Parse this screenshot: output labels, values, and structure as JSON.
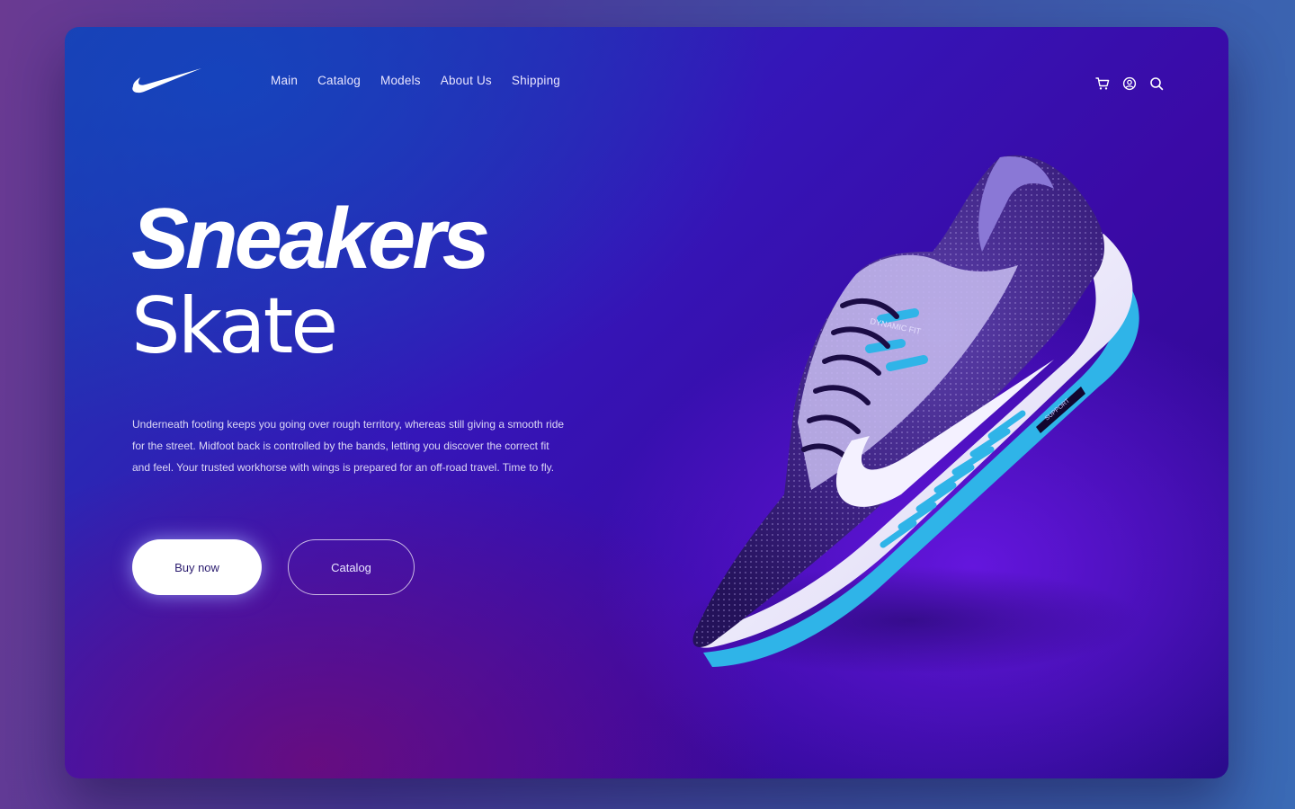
{
  "brand": {
    "logo_icon": "swoosh-logo-icon"
  },
  "nav": {
    "items": [
      {
        "label": "Main"
      },
      {
        "label": "Catalog"
      },
      {
        "label": "Models"
      },
      {
        "label": "About Us"
      },
      {
        "label": "Shipping"
      }
    ]
  },
  "header_icons": [
    "cart-icon",
    "account-icon",
    "search-icon"
  ],
  "hero": {
    "title_line1": "Sneakers",
    "title_line2": "Skate",
    "description": "Underneath footing keeps you going over rough territory, whereas still giving a smooth ride for the street. Midfoot back is controlled by the bands, letting you discover the correct fit and feel. Your trusted workhorse with wings is prepared for an off-road travel. Time to fly."
  },
  "buttons": {
    "buy_now": "Buy now",
    "catalog": "Catalog"
  },
  "product_image": {
    "label_dynamic_fit": "DYNAMIC FIT",
    "label_support": "SUPPORT"
  },
  "colors": {
    "accent_blue": "#2fb4e8",
    "card_top": "#1b3fae",
    "card_mid": "#3516b8",
    "card_bottom": "#6e0c78",
    "shoe_body": "#3b1f7a",
    "shoe_sole": "#f1eefc"
  }
}
